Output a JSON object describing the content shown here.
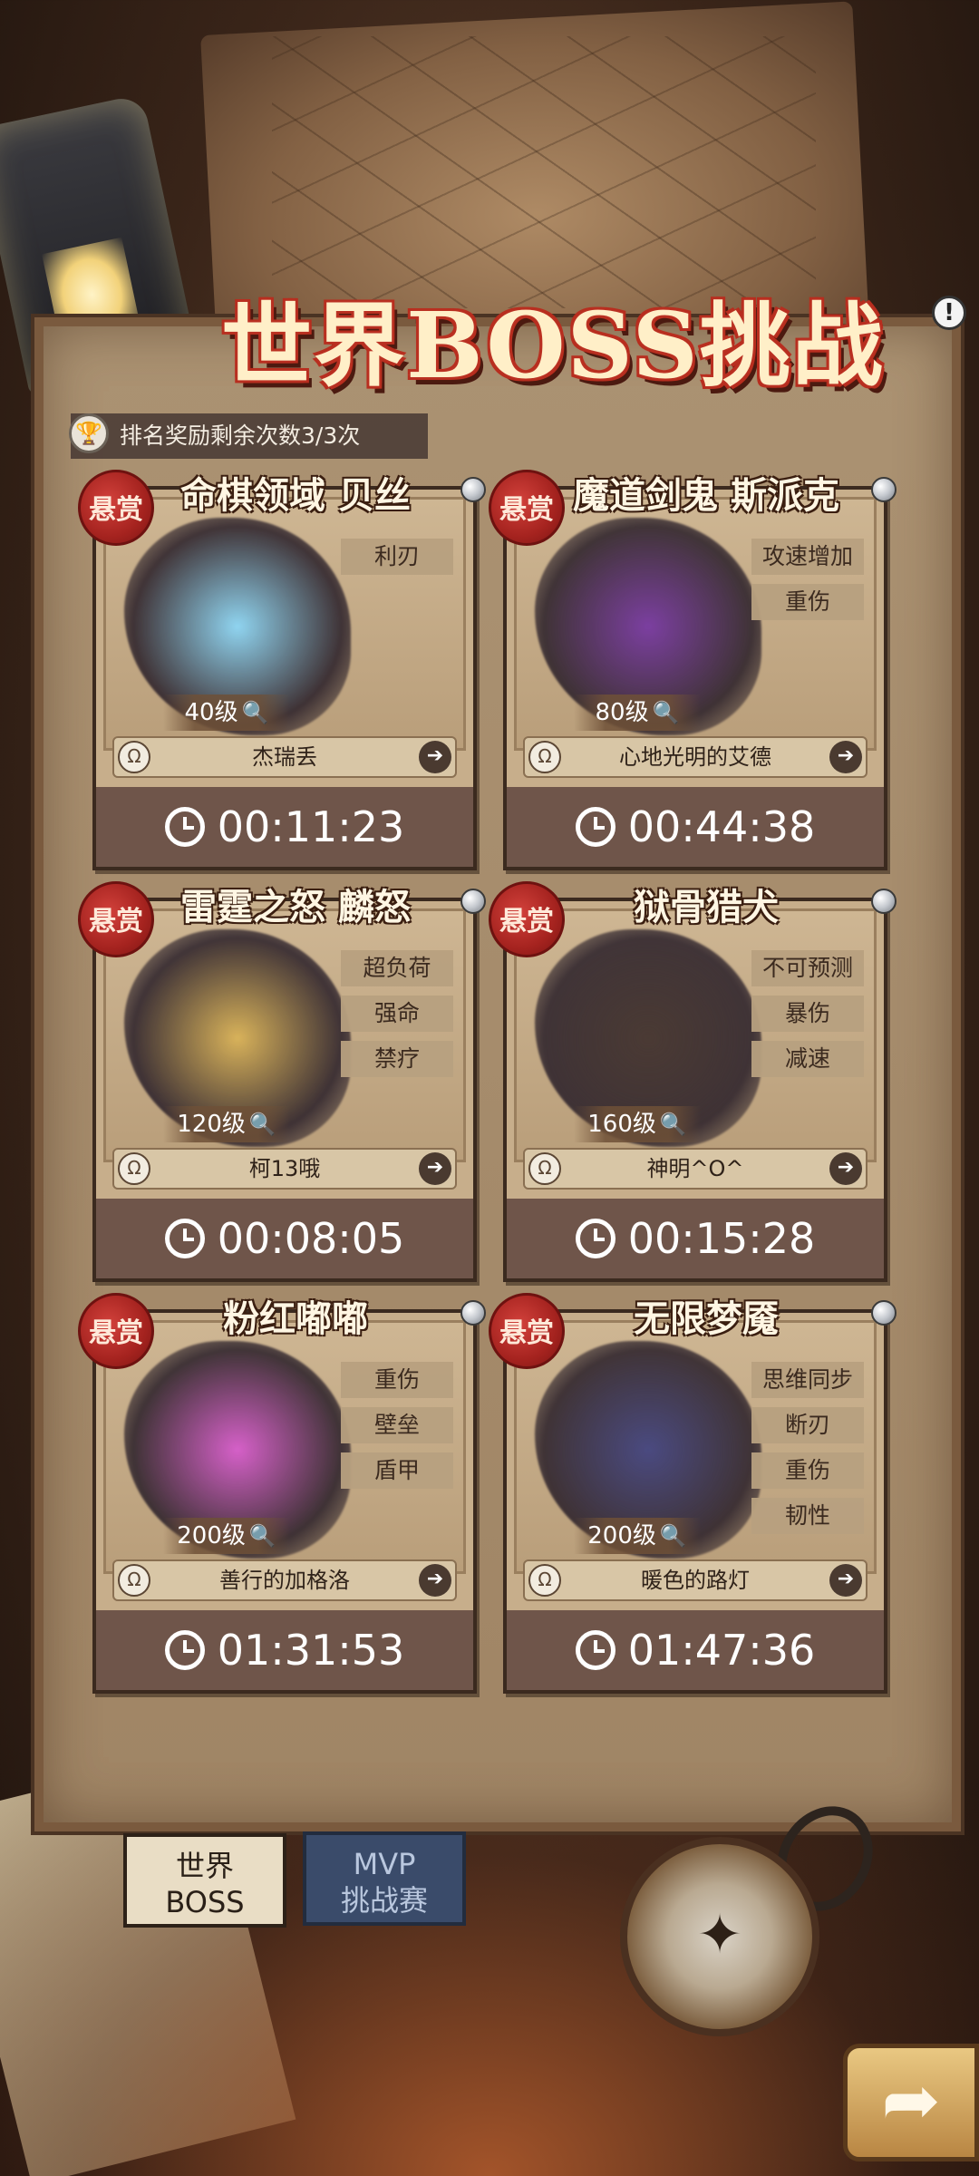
{
  "header": {
    "title": "世界BOSS挑战",
    "info_icon": "!",
    "reward_text": "排名奖励剩余次数3/3次"
  },
  "bosses": [
    {
      "badge": "悬赏",
      "name": "命棋领域 贝丝",
      "tags": [
        "利刃"
      ],
      "level": "40级",
      "player": "杰瑞丢",
      "timer": "00:11:23",
      "color": "#8fd4f0"
    },
    {
      "badge": "悬赏",
      "name": "魔道剑鬼 斯派克",
      "tags": [
        "攻速增加",
        "重伤"
      ],
      "level": "80级",
      "player": "心地光明的艾德",
      "timer": "00:44:38",
      "color": "#7b3fa0"
    },
    {
      "badge": "悬赏",
      "name": "雷霆之怒 麟怒",
      "tags": [
        "超负荷",
        "强命",
        "禁疗"
      ],
      "level": "120级",
      "player": "柯13哦",
      "timer": "00:08:05",
      "color": "#d8b25a"
    },
    {
      "badge": "悬赏",
      "name": "狱骨猎犬",
      "tags": [
        "不可预测",
        "暴伤",
        "减速"
      ],
      "level": "160级",
      "player": "神明^O^",
      "timer": "00:15:28",
      "color": "#4a3a34"
    },
    {
      "badge": "悬赏",
      "name": "粉红嘟嘟",
      "tags": [
        "重伤",
        "壁垒",
        "盾甲"
      ],
      "level": "200级",
      "player": "善行的加格洛",
      "timer": "01:31:53",
      "color": "#d560c8"
    },
    {
      "badge": "悬赏",
      "name": "无限梦魇",
      "tags": [
        "思维同步",
        "断刃",
        "重伤",
        "韧性"
      ],
      "level": "200级",
      "player": "暖色的路灯",
      "timer": "01:47:36",
      "color": "#4a4a80"
    }
  ],
  "tabs": {
    "world": [
      "世界",
      "BOSS"
    ],
    "mvp": [
      "MVP",
      "挑战赛"
    ]
  },
  "icons": {
    "search": "🔍",
    "go": "➔",
    "next": "➦",
    "compass": "✦",
    "trophy": "🏆"
  }
}
